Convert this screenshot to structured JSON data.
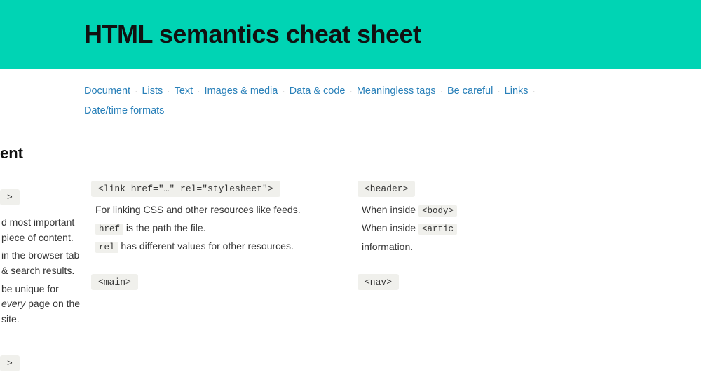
{
  "header": {
    "title": "HTML semantics cheat sheet",
    "bg_color": "#00d4b4"
  },
  "nav": {
    "items": [
      {
        "label": "Document",
        "href": "#"
      },
      {
        "label": "Lists",
        "href": "#"
      },
      {
        "label": "Text",
        "href": "#"
      },
      {
        "label": "Images & media",
        "href": "#"
      },
      {
        "label": "Data & code",
        "href": "#"
      },
      {
        "label": "Meaningless tags",
        "href": "#"
      },
      {
        "label": "Be careful",
        "href": "#"
      },
      {
        "label": "Links",
        "href": "#"
      },
      {
        "label": "Date/time formats",
        "href": "#"
      }
    ],
    "separator": "·"
  },
  "content": {
    "section_label": "ent",
    "left_partial": {
      "code": ">",
      "lines": [
        "d most important piece of content.",
        "in the browser tab & search results.",
        "be unique for every page on the site."
      ],
      "every_italic": "every"
    },
    "middle": {
      "tag": "<link href=\"…\" rel=\"stylesheet\">",
      "desc_line1": "For linking CSS and other resources like feeds.",
      "desc_line2_pre": "href",
      "desc_line2_text": " is the path the file.",
      "desc_line3_pre": "rel",
      "desc_line3_text": " has different values for other resources.",
      "bottom_tag": "<main>"
    },
    "right": {
      "tag": "<header>",
      "desc_line1": "When inside",
      "desc_code1": "<body>",
      "desc_line1b": "",
      "desc_line2": "When inside",
      "desc_code2": "<arti",
      "desc_line2b": "",
      "desc_line3": "information.",
      "bottom_tag": "<nav>"
    }
  }
}
